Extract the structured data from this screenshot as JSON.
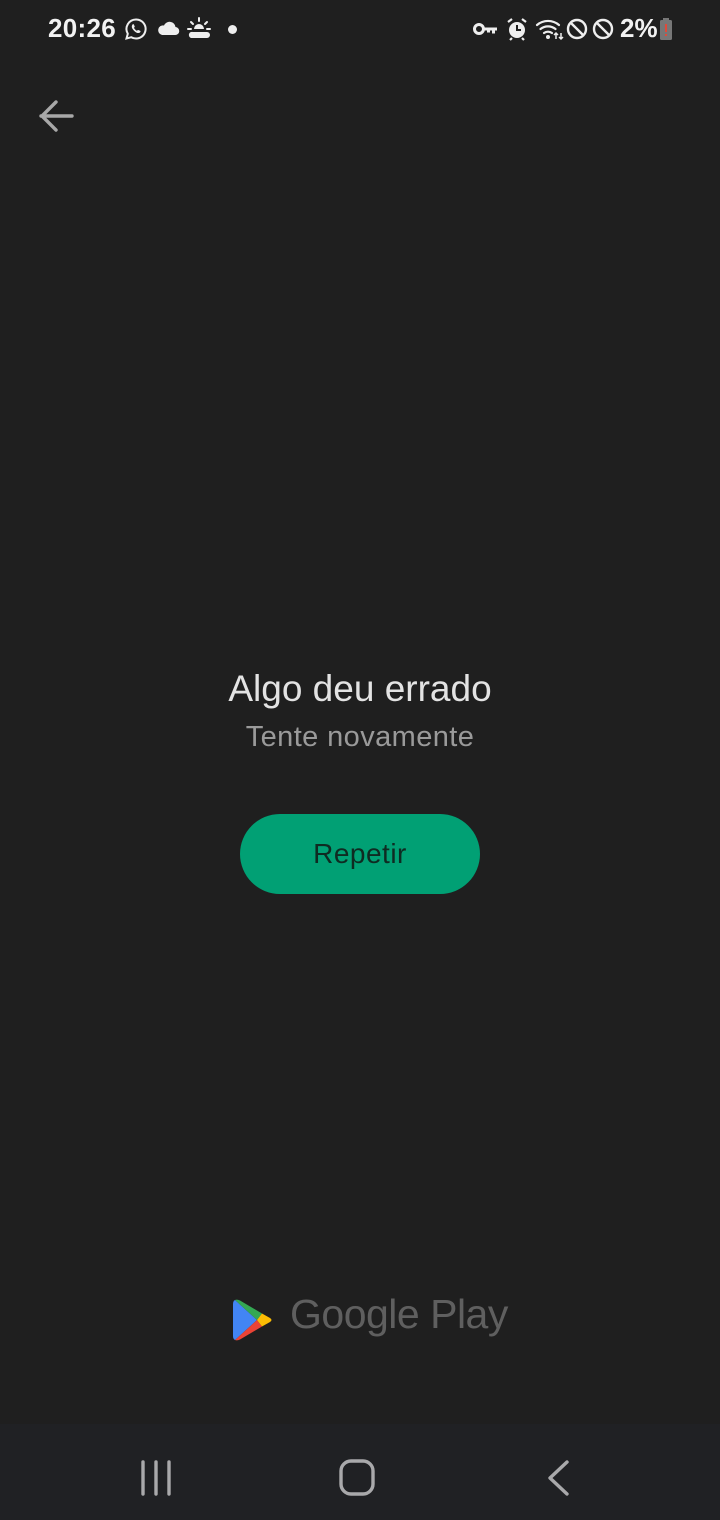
{
  "status_bar": {
    "time": "20:26",
    "left_icons": [
      "whatsapp-icon",
      "cloud-icon",
      "weather-sun-cloud-icon",
      "notification-dot-icon"
    ],
    "right_icons": [
      "vpn-key-icon",
      "alarm-icon",
      "wifi-icon",
      "do-not-disturb-icon",
      "do-not-disturb-icon"
    ],
    "battery_percent": "2%",
    "battery_level": 0.02
  },
  "header": {
    "back_icon": "arrow-left-icon"
  },
  "error": {
    "title": "Algo deu errado",
    "subtitle": "Tente novamente",
    "retry_label": "Repetir"
  },
  "colors": {
    "accent": "#01a074",
    "background": "#1f1f1f",
    "nav_bar": "#202124"
  },
  "branding": {
    "text": "Google Play"
  },
  "nav_bar": {
    "buttons": [
      "recent-apps",
      "home",
      "back"
    ]
  }
}
